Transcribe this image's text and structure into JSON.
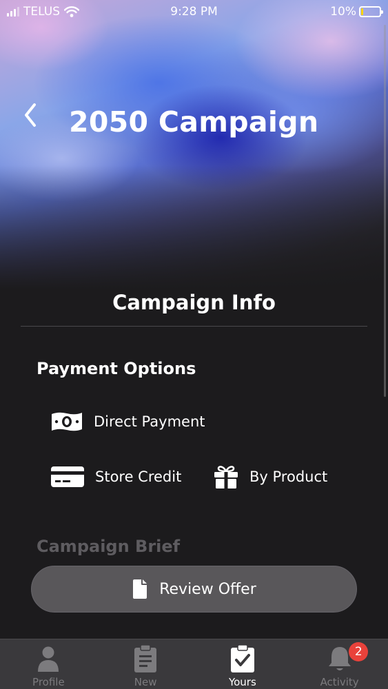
{
  "status_bar": {
    "carrier": "TELUS",
    "time": "9:28 PM",
    "battery": "10%",
    "battery_level": 0.1
  },
  "header": {
    "title": "2050 Campaign",
    "back_icon": "chevron-left-icon"
  },
  "section": {
    "title": "Campaign Info"
  },
  "payment": {
    "heading": "Payment Options",
    "options": [
      {
        "label": "Direct Payment",
        "icon": "money-bill-icon"
      },
      {
        "label": "Store Credit",
        "icon": "credit-card-icon"
      },
      {
        "label": "By Product",
        "icon": "gift-icon"
      }
    ]
  },
  "brief": {
    "heading": "Campaign Brief"
  },
  "review_button": {
    "label": "Review Offer",
    "icon": "document-icon"
  },
  "tabbar": {
    "tabs": [
      {
        "label": "Profile",
        "icon": "person-icon",
        "active": false
      },
      {
        "label": "New",
        "icon": "clipboard-list-icon",
        "active": false
      },
      {
        "label": "Yours",
        "icon": "clipboard-check-icon",
        "active": true
      },
      {
        "label": "Activity",
        "icon": "bell-icon",
        "active": false,
        "badge": "2"
      }
    ]
  },
  "colors": {
    "background": "#1c1b1d",
    "button": "#59575a",
    "tabbar": "#3a393c",
    "badge": "#e9423b",
    "inactive_tab": "#7c7b7e"
  }
}
